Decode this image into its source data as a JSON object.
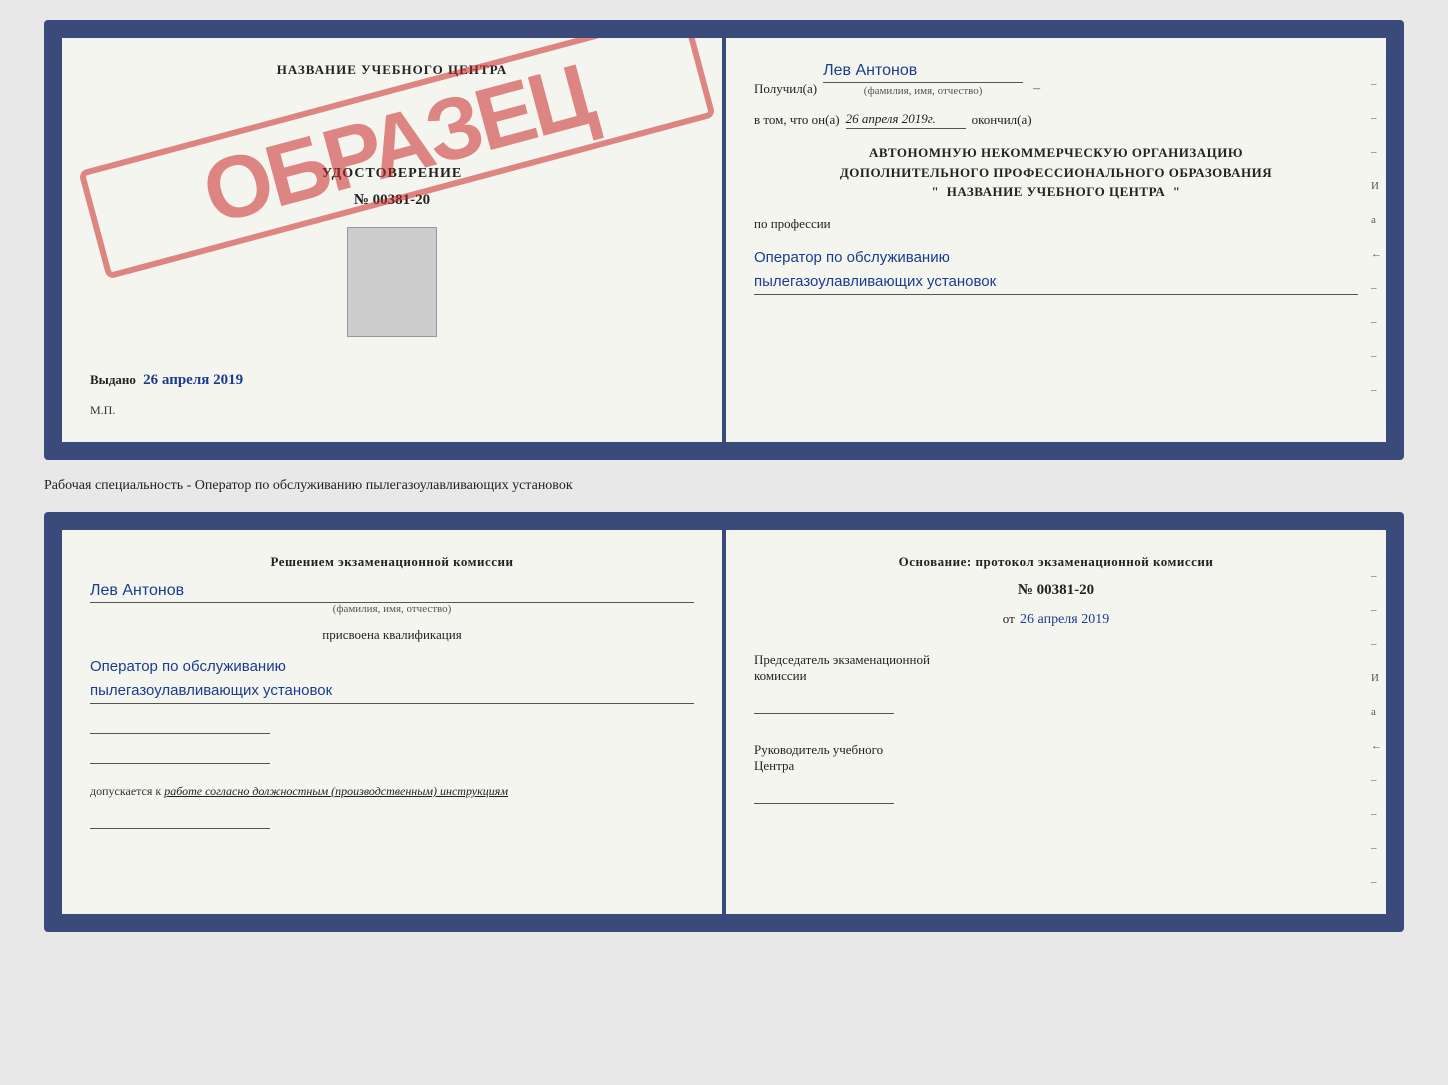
{
  "top_doc": {
    "left": {
      "training_center": "НАЗВАНИЕ УЧЕБНОГО ЦЕНТРА",
      "sample_text": "ОБРАЗЕЦ",
      "cert_type": "УДОСТОВЕРЕНИЕ",
      "cert_number": "№ 00381-20",
      "issued_label": "Выдано",
      "issued_date": "26 апреля 2019",
      "mp_label": "М.П."
    },
    "right": {
      "received_label": "Получил(а)",
      "recipient_name": "Лев Антонов",
      "fio_label": "(фамилия, имя, отчество)",
      "dash1": "–",
      "in_that_label": "в том, что он(а)",
      "completion_date": "26 апреля 2019г.",
      "completed_label": "окончил(а)",
      "org_line1": "АВТОНОМНУЮ НЕКОММЕРЧЕСКУЮ ОРГАНИЗАЦИЮ",
      "org_line2": "ДОПОЛНИТЕЛЬНОГО ПРОФЕССИОНАЛЬНОГО ОБРАЗОВАНИЯ",
      "org_quote1": "\"",
      "org_name": "НАЗВАНИЕ УЧЕБНОГО ЦЕНТРА",
      "org_quote2": "\"",
      "profession_label": "по профессии",
      "profession_line1": "Оператор по обслуживанию",
      "profession_line2": "пылегазоулавливающих установок",
      "side_marks": [
        "–",
        "–",
        "–",
        "И",
        "а",
        "←",
        "–",
        "–",
        "–",
        "–"
      ]
    }
  },
  "specialty_label": "Рабочая специальность - Оператор по обслуживанию пылегазоулавливающих установок",
  "bottom_doc": {
    "left": {
      "commission_heading": "Решением экзаменационной комиссии",
      "person_name": "Лев Антонов",
      "fio_label": "(фамилия, имя, отчество)",
      "qualification_label": "присвоена квалификация",
      "qualification_line1": "Оператор по обслуживанию",
      "qualification_line2": "пылегазоулавливающих установок",
      "allowed_prefix": "допускается к",
      "allowed_italic": "работе согласно должностным (производственным) инструкциям"
    },
    "right": {
      "basis_heading": "Основание: протокол экзаменационной комиссии",
      "protocol_number": "№ 00381-20",
      "date_prefix": "от",
      "protocol_date": "26 апреля 2019",
      "chairman_line1": "Председатель экзаменационной",
      "chairman_line2": "комиссии",
      "leader_line1": "Руководитель учебного",
      "leader_line2": "Центра",
      "side_marks": [
        "–",
        "–",
        "–",
        "И",
        "а",
        "←",
        "–",
        "–",
        "–",
        "–"
      ]
    }
  }
}
